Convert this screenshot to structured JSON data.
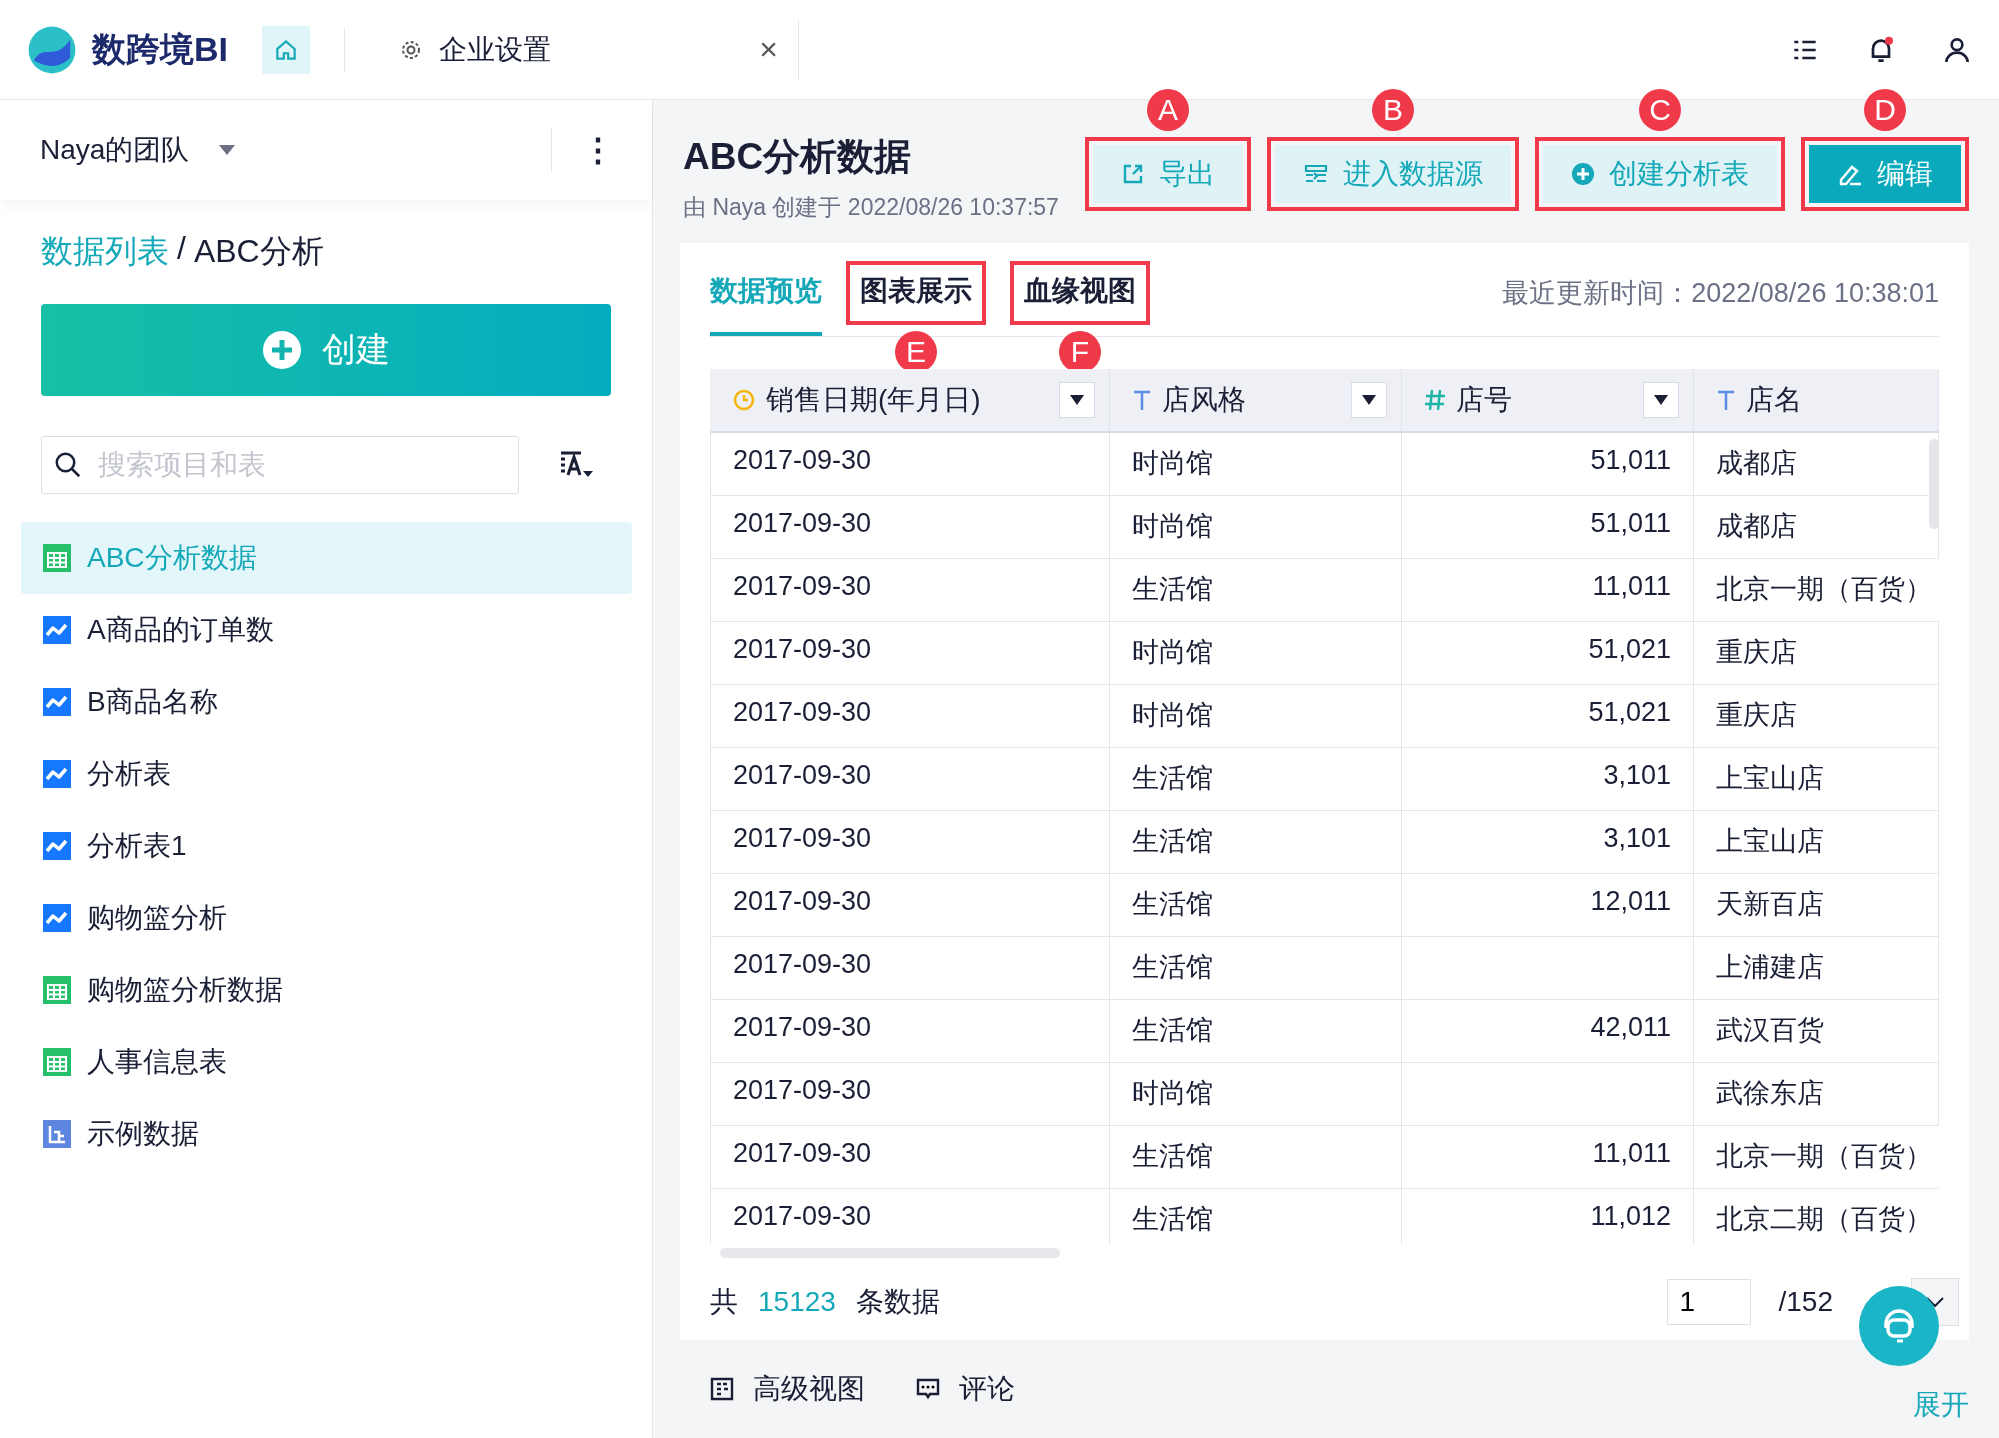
{
  "app": {
    "name": "数跨境BI"
  },
  "tabs": [
    {
      "label": "企业设置",
      "close": "×"
    }
  ],
  "team": {
    "name": "Naya的团队",
    "more": "⋮"
  },
  "breadcrumb": {
    "parent": "数据列表",
    "separator": "/",
    "current": "ABC分析"
  },
  "create_button": {
    "label": "创建"
  },
  "search": {
    "placeholder": "搜索项目和表"
  },
  "items": [
    {
      "label": "ABC分析数据",
      "kind": "table",
      "selected": true
    },
    {
      "label": "A商品的订单数",
      "kind": "chart",
      "selected": false
    },
    {
      "label": "B商品名称",
      "kind": "chart",
      "selected": false
    },
    {
      "label": "分析表",
      "kind": "chart",
      "selected": false
    },
    {
      "label": "分析表1",
      "kind": "chart",
      "selected": false
    },
    {
      "label": "购物篮分析",
      "kind": "chart",
      "selected": false
    },
    {
      "label": "购物篮分析数据",
      "kind": "table",
      "selected": false
    },
    {
      "label": "人事信息表",
      "kind": "table",
      "selected": false
    },
    {
      "label": "示例数据",
      "kind": "sample",
      "selected": false
    }
  ],
  "header": {
    "title": "ABC分析数据",
    "subtitle": "由 Naya 创建于 2022/08/26 10:37:57"
  },
  "actions": [
    {
      "label": "导出",
      "kind": "export",
      "primary": false,
      "callout": "A"
    },
    {
      "label": "进入数据源",
      "kind": "source",
      "primary": false,
      "callout": "B"
    },
    {
      "label": "创建分析表",
      "kind": "create",
      "primary": false,
      "callout": "C"
    },
    {
      "label": "编辑",
      "kind": "edit",
      "primary": true,
      "callout": "D"
    }
  ],
  "view_tabs": [
    {
      "label": "数据预览",
      "selected": true
    },
    {
      "label": "图表展示",
      "selected": false,
      "callout": "E"
    },
    {
      "label": "血缘视图",
      "selected": false,
      "callout": "F"
    }
  ],
  "updated": "最近更新时间：2022/08/26 10:38:01",
  "table": {
    "columns": [
      {
        "label": "销售日期(年月日)",
        "kind": "date",
        "menu": true
      },
      {
        "label": "店风格",
        "kind": "text",
        "menu": true
      },
      {
        "label": "店号",
        "kind": "number",
        "menu": true
      },
      {
        "label": "店名",
        "kind": "text",
        "menu": false
      }
    ],
    "rows": [
      [
        "2017-09-30",
        "时尚馆",
        "51,011",
        "成都店"
      ],
      [
        "2017-09-30",
        "时尚馆",
        "51,011",
        "成都店"
      ],
      [
        "2017-09-30",
        "生活馆",
        "11,011",
        "北京一期（百货）"
      ],
      [
        "2017-09-30",
        "时尚馆",
        "51,021",
        "重庆店"
      ],
      [
        "2017-09-30",
        "时尚馆",
        "51,021",
        "重庆店"
      ],
      [
        "2017-09-30",
        "生活馆",
        "3,101",
        "上宝山店"
      ],
      [
        "2017-09-30",
        "生活馆",
        "3,101",
        "上宝山店"
      ],
      [
        "2017-09-30",
        "生活馆",
        "12,011",
        "天新百店"
      ],
      [
        "2017-09-30",
        "生活馆",
        "",
        "上浦建店"
      ],
      [
        "2017-09-30",
        "生活馆",
        "42,011",
        "武汉百货"
      ],
      [
        "2017-09-30",
        "时尚馆",
        "",
        "武徐东店"
      ],
      [
        "2017-09-30",
        "生活馆",
        "11,011",
        "北京一期（百货）"
      ],
      [
        "2017-09-30",
        "生活馆",
        "11,012",
        "北京二期（百货）"
      ]
    ]
  },
  "pagination": {
    "prefix": "共",
    "total": "15123",
    "suffix": "条数据",
    "page": "1",
    "pages": "/152"
  },
  "footer": [
    {
      "label": "高级视图",
      "kind": "view"
    },
    {
      "label": "评论",
      "kind": "comment"
    }
  ],
  "expand": "展开"
}
